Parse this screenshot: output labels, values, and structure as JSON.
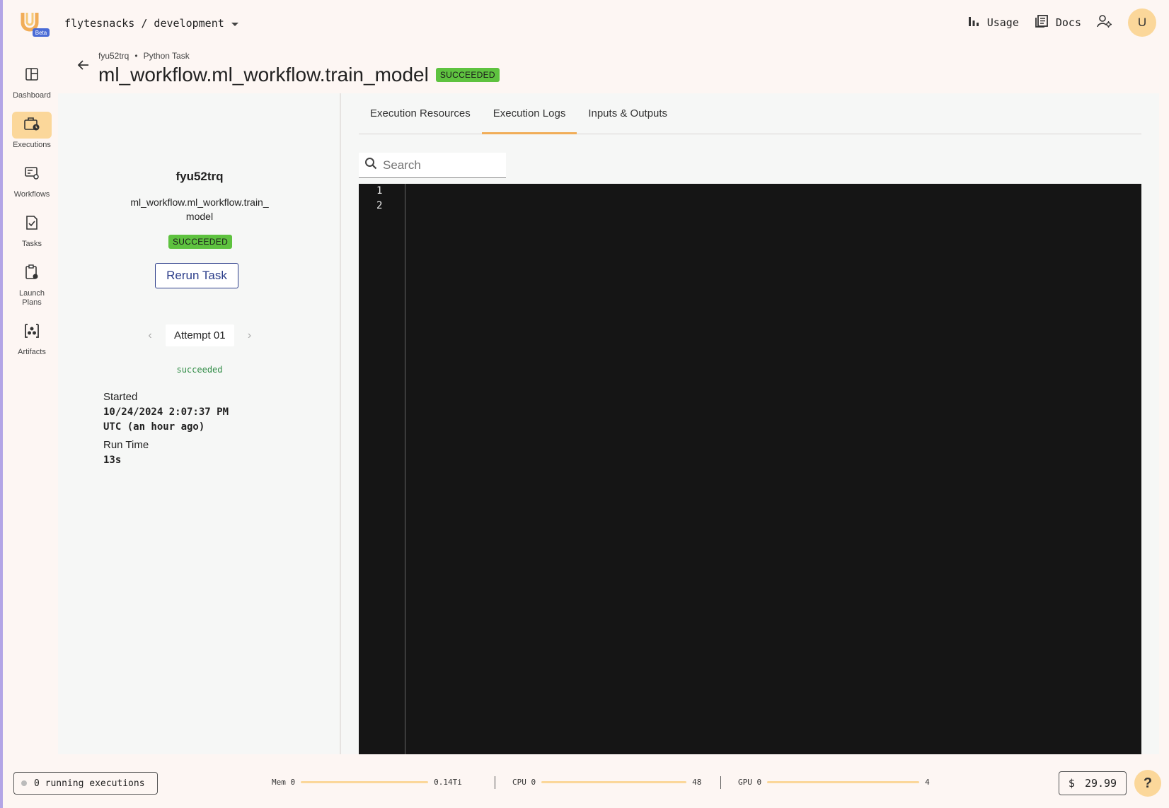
{
  "app": {
    "logo_badge": "Beta",
    "project_path": "flytesnacks / development"
  },
  "topbar": {
    "usage_label": "Usage",
    "docs_label": "Docs",
    "avatar_initial": "U"
  },
  "nav": {
    "items": [
      {
        "label": "Dashboard",
        "icon": "dashboard-icon",
        "active": false
      },
      {
        "label": "Executions",
        "icon": "executions-icon",
        "active": true
      },
      {
        "label": "Workflows",
        "icon": "workflows-icon",
        "active": false
      },
      {
        "label": "Tasks",
        "icon": "tasks-icon",
        "active": false
      },
      {
        "label": "Launch Plans",
        "icon": "launch-plans-icon",
        "active": false
      },
      {
        "label": "Artifacts",
        "icon": "artifacts-icon",
        "active": false
      }
    ]
  },
  "header": {
    "breadcrumb_exec": "fyu52trq",
    "breadcrumb_sep": "•",
    "breadcrumb_type": "Python Task",
    "title": "ml_workflow.ml_workflow.train_model",
    "status": "SUCCEEDED"
  },
  "details": {
    "execution_id": "fyu52trq",
    "task_name": "ml_workflow.ml_workflow.train_model",
    "status": "SUCCEEDED",
    "rerun_label": "Rerun Task",
    "attempt_label": "Attempt 01",
    "attempt_status": "succeeded",
    "started_label": "Started",
    "started_value": "10/24/2024 2:07:37 PM UTC (an hour ago)",
    "runtime_label": "Run Time",
    "runtime_value": "13s"
  },
  "tabs": [
    {
      "label": "Execution Resources",
      "active": false
    },
    {
      "label": "Execution Logs",
      "active": true
    },
    {
      "label": "Inputs & Outputs",
      "active": false
    }
  ],
  "logs": {
    "search_placeholder": "Search",
    "line_numbers": [
      "1",
      "2"
    ]
  },
  "footer": {
    "running_executions": "0 running executions",
    "mem_label": "Mem 0",
    "mem_max": "0.14Ti",
    "cpu_label": "CPU 0",
    "cpu_max": "48",
    "gpu_label": "GPU 0",
    "gpu_max": "4",
    "cost_symbol": "$",
    "cost_value": "29.99",
    "help_label": "?"
  },
  "colors": {
    "accent": "#fbd79a",
    "success": "#5ec23f",
    "primary": "#2b3d8a",
    "tab_underline": "#f1ad58",
    "console_bg": "#151515"
  }
}
